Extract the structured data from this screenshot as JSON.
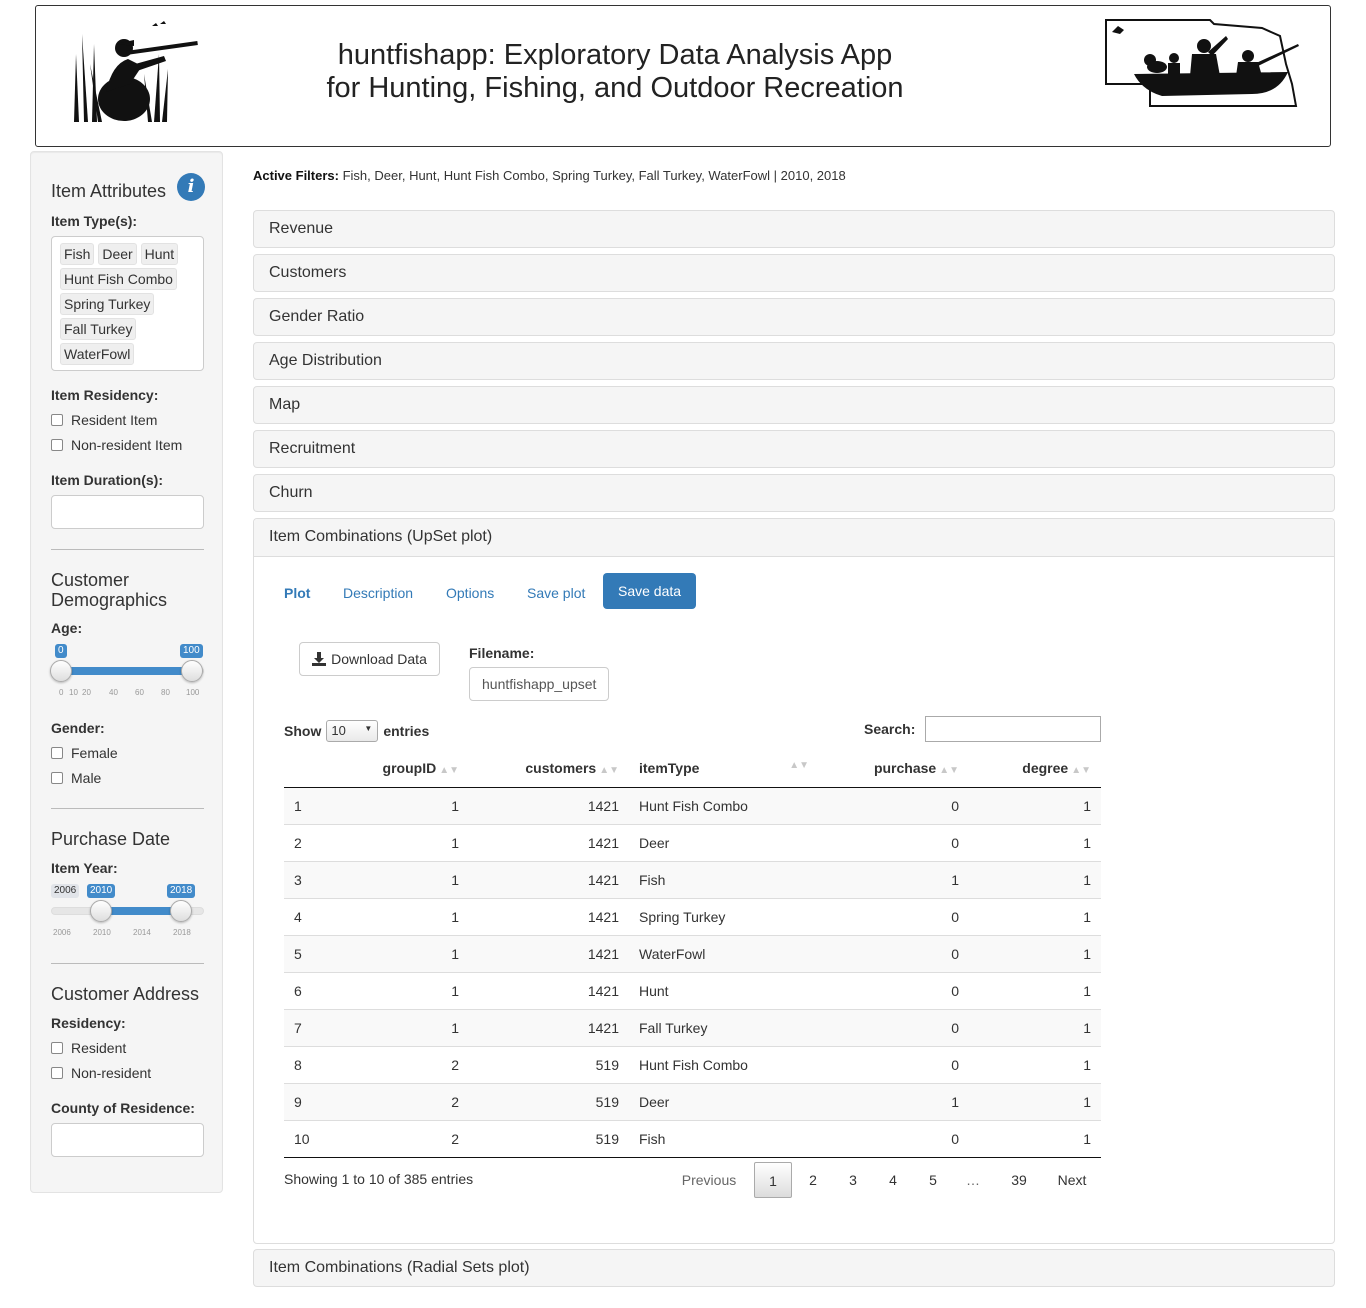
{
  "header": {
    "title_line1": "huntfishapp: Exploratory Data Analysis App",
    "title_line2": "for Hunting, Fishing, and Outdoor Recreation"
  },
  "sidebar": {
    "item_attributes": {
      "heading": "Item Attributes",
      "item_types_label": "Item Type(s):",
      "item_types": [
        "Fish",
        "Deer",
        "Hunt",
        "Hunt Fish Combo",
        "Spring Turkey",
        "Fall Turkey",
        "WaterFowl"
      ],
      "residency_label": "Item Residency:",
      "residency_options": [
        "Resident Item",
        "Non-resident Item"
      ],
      "duration_label": "Item Duration(s):"
    },
    "customer_demographics": {
      "heading": "Customer Demographics",
      "age_label": "Age:",
      "age_min": "0",
      "age_max": "100",
      "age_ticks": [
        "0",
        "10",
        "20",
        "40",
        "60",
        "80",
        "100"
      ],
      "gender_label": "Gender:",
      "gender_options": [
        "Female",
        "Male"
      ]
    },
    "purchase_date": {
      "heading": "Purchase Date",
      "year_label": "Item Year:",
      "range_min": "2006",
      "year_from": "2010",
      "year_to": "2018",
      "year_ticks": [
        "2006",
        "2010",
        "2014",
        "2018"
      ]
    },
    "customer_address": {
      "heading": "Customer Address",
      "residency_label": "Residency:",
      "residency_options": [
        "Resident",
        "Non-resident"
      ],
      "county_label": "County of Residence:"
    }
  },
  "main": {
    "active_filters_label": "Active Filters:",
    "active_filters_value": " Fish, Deer, Hunt, Hunt Fish Combo, Spring Turkey, Fall Turkey, WaterFowl | 2010, 2018",
    "panels": [
      "Revenue",
      "Customers",
      "Gender Ratio",
      "Age Distribution",
      "Map",
      "Recruitment",
      "Churn"
    ],
    "open_panel": "Item Combinations (UpSet plot)",
    "last_panel": "Item Combinations (Radial Sets plot)",
    "tabs": {
      "plot": "Plot",
      "description": "Description",
      "options": "Options",
      "save_plot": "Save plot",
      "save_data": "Save data"
    },
    "download_label": "Download Data",
    "filename_label": "Filename:",
    "filename_value": "huntfishapp_upset",
    "table": {
      "show_label": "Show",
      "entries_label": "entries",
      "page_length": "10",
      "search_label": "Search:",
      "columns": [
        "groupID",
        "customers",
        "itemType",
        "purchase",
        "degree"
      ],
      "rows": [
        [
          "1",
          "1",
          "1421",
          "Hunt Fish Combo",
          "0",
          "1"
        ],
        [
          "2",
          "1",
          "1421",
          "Deer",
          "0",
          "1"
        ],
        [
          "3",
          "1",
          "1421",
          "Fish",
          "1",
          "1"
        ],
        [
          "4",
          "1",
          "1421",
          "Spring Turkey",
          "0",
          "1"
        ],
        [
          "5",
          "1",
          "1421",
          "WaterFowl",
          "0",
          "1"
        ],
        [
          "6",
          "1",
          "1421",
          "Hunt",
          "0",
          "1"
        ],
        [
          "7",
          "1",
          "1421",
          "Fall Turkey",
          "0",
          "1"
        ],
        [
          "8",
          "2",
          "519",
          "Hunt Fish Combo",
          "0",
          "1"
        ],
        [
          "9",
          "2",
          "519",
          "Deer",
          "1",
          "1"
        ],
        [
          "10",
          "2",
          "519",
          "Fish",
          "0",
          "1"
        ]
      ],
      "info": "Showing 1 to 10 of 385 entries",
      "pagination": {
        "previous": "Previous",
        "pages": [
          "1",
          "2",
          "3",
          "4",
          "5"
        ],
        "ellipsis": "…",
        "last_page": "39",
        "next": "Next"
      }
    }
  },
  "colors": {
    "accent": "#337ab7",
    "slider": "#428bca",
    "panel_bg": "#f5f5f5",
    "sidebar_bg": "#f5f5f5"
  }
}
